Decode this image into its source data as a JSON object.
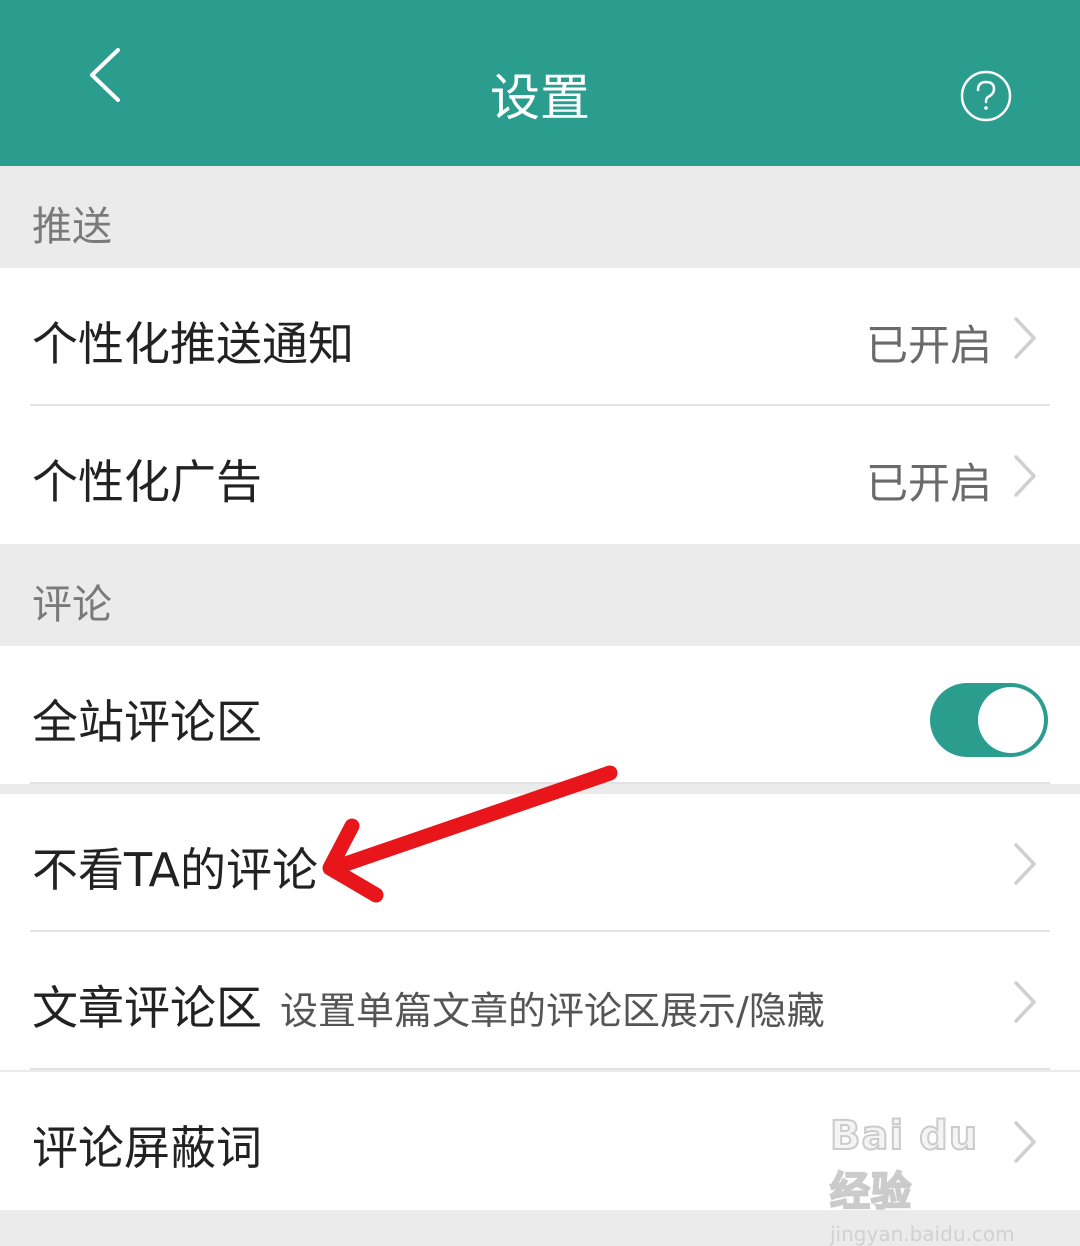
{
  "header": {
    "title": "设置",
    "back_icon": "chevron-left-icon",
    "help_icon": "help-circle-icon",
    "background": "#2a9d8f"
  },
  "sections": {
    "push": {
      "title": "推送",
      "items": [
        {
          "label": "个性化推送通知",
          "value": "已开启"
        },
        {
          "label": "个性化广告",
          "value": "已开启"
        }
      ]
    },
    "comments": {
      "title": "评论",
      "items": [
        {
          "label": "全站评论区",
          "toggle_on": true
        },
        {
          "label": "不看TA的评论"
        },
        {
          "label": "文章评论区",
          "subtitle": "设置单篇文章的评论区展示/隐藏"
        },
        {
          "label": "评论屏蔽词"
        }
      ]
    }
  },
  "annotation": {
    "arrow_color": "#e8151b"
  },
  "watermark": {
    "logo_text": "Bai du 经验",
    "url": "jingyan.baidu.com"
  }
}
